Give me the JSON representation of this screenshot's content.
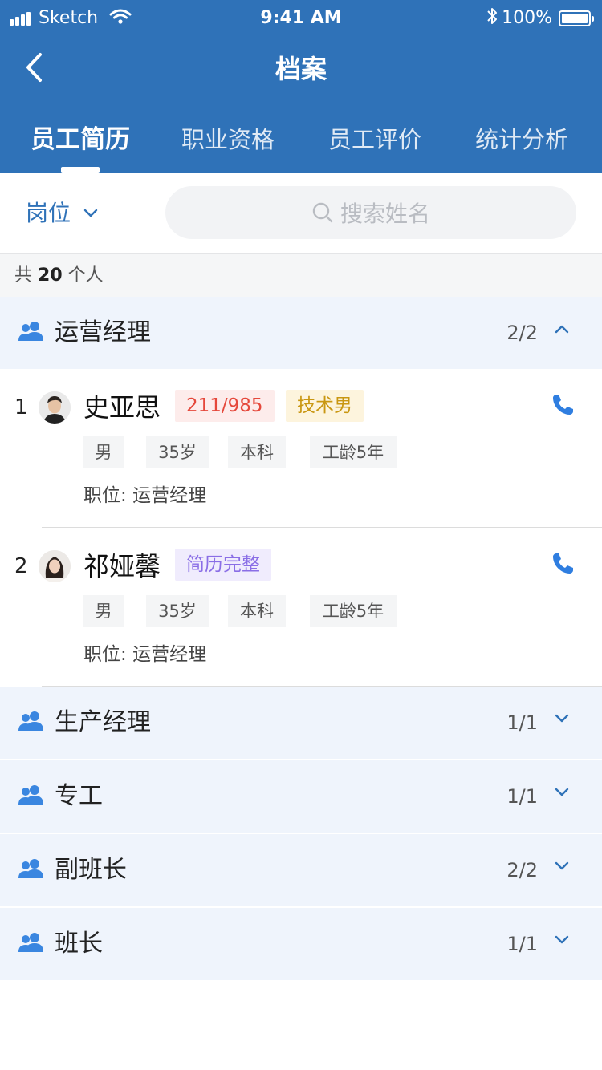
{
  "status_bar": {
    "carrier": "Sketch",
    "time": "9:41 AM",
    "battery": "100%"
  },
  "nav": {
    "title": "档案"
  },
  "tabs": [
    {
      "label": "员工简历",
      "active": true
    },
    {
      "label": "职业资格",
      "active": false
    },
    {
      "label": "员工评价",
      "active": false
    },
    {
      "label": "统计分析",
      "active": false
    }
  ],
  "filter": {
    "post_label": "岗位",
    "search_placeholder": "搜索姓名"
  },
  "summary": {
    "prefix": "共",
    "count": "20",
    "suffix": "个人"
  },
  "groups": [
    {
      "title": "运营经理",
      "count": "2/2",
      "expanded": true,
      "employees": [
        {
          "index": "1",
          "name": "史亚思",
          "tags": [
            {
              "text": "211/985",
              "color": "#e5483b",
              "bg": "#fdeceb"
            },
            {
              "text": "技术男",
              "color": "#c99712",
              "bg": "#fdf4dd"
            }
          ],
          "gender": "男",
          "age": "35岁",
          "education": "本科",
          "seniority": "工龄5年",
          "position_label": "职位:",
          "position": "运营经理"
        },
        {
          "index": "2",
          "name": "祁娅馨",
          "tags": [
            {
              "text": "简历完整",
              "color": "#8a6ee6",
              "bg": "#f0ecfd"
            }
          ],
          "gender": "男",
          "age": "35岁",
          "education": "本科",
          "seniority": "工龄5年",
          "position_label": "职位:",
          "position": "运营经理"
        }
      ]
    },
    {
      "title": "生产经理",
      "count": "1/1",
      "expanded": false
    },
    {
      "title": "专工",
      "count": "1/1",
      "expanded": false
    },
    {
      "title": "副班长",
      "count": "2/2",
      "expanded": false
    },
    {
      "title": "班长",
      "count": "1/1",
      "expanded": false
    }
  ],
  "colors": {
    "primary": "#2f72b8",
    "group_bg": "#eff4fc",
    "phone": "#2f7ee0"
  },
  "icons": {
    "back": "chevron-left-icon",
    "search": "search-icon",
    "group": "people-icon",
    "phone": "phone-icon"
  }
}
